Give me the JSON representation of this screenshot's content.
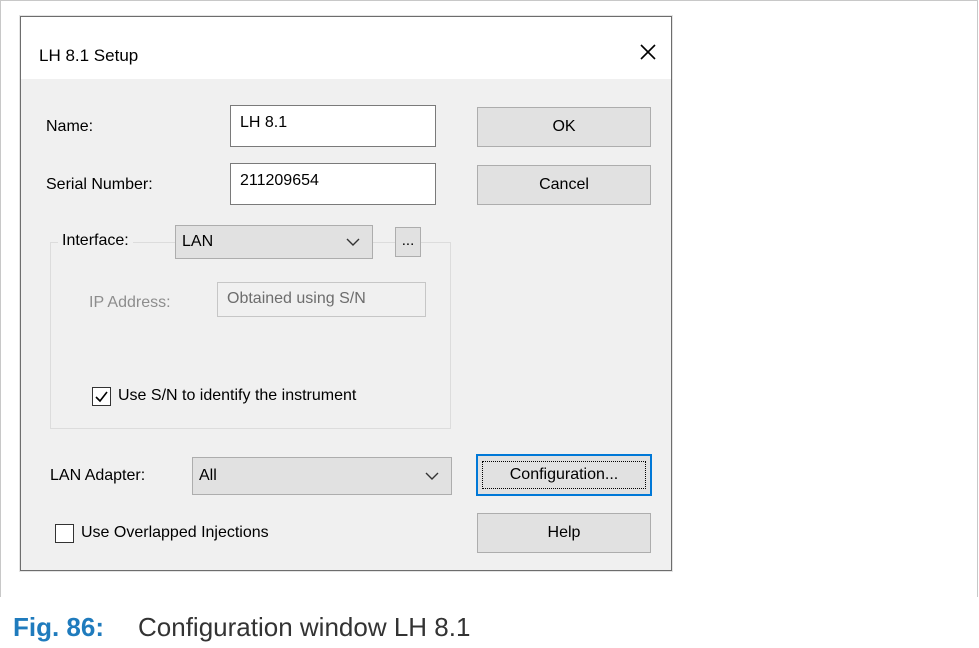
{
  "dialog": {
    "title": "LH 8.1 Setup",
    "name_label": "Name:",
    "name_value": "LH 8.1",
    "serial_label": "Serial Number:",
    "serial_value": "211209654",
    "ok_label": "OK",
    "cancel_label": "Cancel",
    "interface_label": "Interface:",
    "interface_value": "LAN",
    "browse_label": "...",
    "ip_label": "IP Address:",
    "ip_value": "Obtained using S/N",
    "use_sn_label": "Use S/N to identify the instrument",
    "use_sn_checked": true,
    "lan_adapter_label": "LAN Adapter:",
    "lan_adapter_value": "All",
    "configuration_label": "Configuration...",
    "overlapped_label": "Use Overlapped Injections",
    "overlapped_checked": false,
    "help_label": "Help"
  },
  "caption": {
    "number": "Fig. 86:",
    "text": "Configuration window LH 8.1"
  },
  "icons": [
    "close-icon",
    "chevron-down-icon",
    "checkmark-icon"
  ],
  "colors": {
    "accent": "#0078d7",
    "caption_number": "#1f7bbd",
    "dialog_bg": "#f0f0f0"
  }
}
